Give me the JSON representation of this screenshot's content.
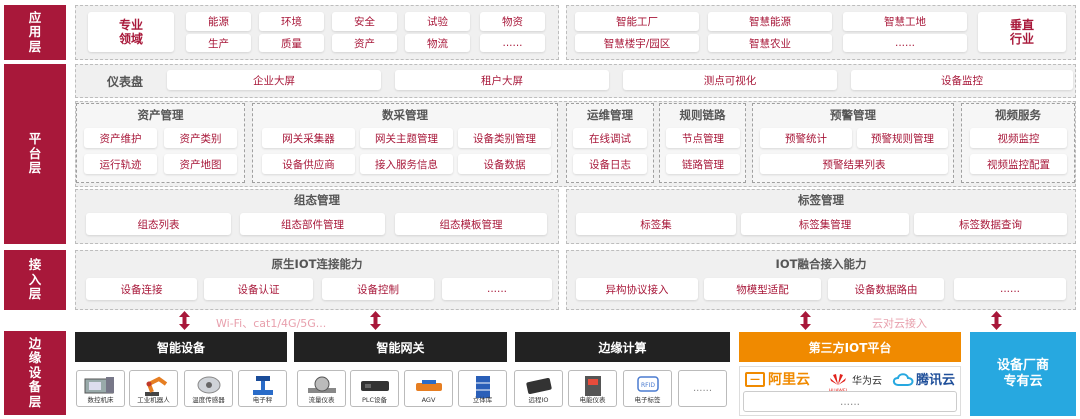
{
  "layers": {
    "app": "应用层",
    "platform": "平台层",
    "access": "接入层",
    "edge": "边缘设备层"
  },
  "app": {
    "left_tag": "专业\n领域",
    "left_items": [
      "能源",
      "环境",
      "安全",
      "试验",
      "物资",
      "生产",
      "质量",
      "资产",
      "物流",
      "......"
    ],
    "right_items": [
      "智能工厂",
      "智慧能源",
      "智慧工地",
      "智慧楼宇/园区",
      "智慧农业",
      "......"
    ],
    "right_tag": "垂直\n行业"
  },
  "platform": {
    "dashboard_label": "仪表盘",
    "dashboard_items": [
      "企业大屏",
      "租户大屏",
      "测点可视化",
      "设备监控"
    ],
    "asset": {
      "title": "资产管理",
      "items": [
        "资产维护",
        "资产类别",
        "运行轨迹",
        "资产地图"
      ]
    },
    "collect": {
      "title": "数采管理",
      "items": [
        "网关采集器",
        "网关主题管理",
        "设备类别管理",
        "设备供应商",
        "接入服务信息",
        "设备数据"
      ]
    },
    "ops": {
      "title": "运维管理",
      "items": [
        "在线调试",
        "设备日志"
      ]
    },
    "rule": {
      "title": "规则链路",
      "items": [
        "节点管理",
        "链路管理"
      ]
    },
    "alarm": {
      "title": "预警管理",
      "items": [
        "预警统计",
        "预警规则管理",
        "预警结果列表"
      ]
    },
    "video": {
      "title": "视频服务",
      "items": [
        "视频监控",
        "视频监控配置"
      ]
    },
    "config": {
      "title": "组态管理",
      "items": [
        "组态列表",
        "组态部件管理",
        "组态模板管理"
      ]
    },
    "tag": {
      "title": "标签管理",
      "items": [
        "标签集",
        "标签集管理",
        "标签数据查询"
      ]
    }
  },
  "access": {
    "native": {
      "title": "原生IOT连接能力",
      "items": [
        "设备连接",
        "设备认证",
        "设备控制",
        "......"
      ]
    },
    "fusion": {
      "title": "IOT融合接入能力",
      "items": [
        "异构协议接入",
        "物模型适配",
        "设备数据路由",
        "......"
      ]
    }
  },
  "links": {
    "wifi": "Wi-Fi、cat1/4G/5G...",
    "cloud": "云对云接入"
  },
  "edge": {
    "bars": [
      "智能设备",
      "智能网关",
      "边缘计算",
      "第三方IOT平台",
      "设备厂商\n专有云"
    ],
    "smart_devices": [
      "数控机床",
      "工业机器人",
      "温度传感器",
      "电子秤"
    ],
    "gateways": [
      "流量仪表",
      "PLC设备",
      "AGV",
      "立体库"
    ],
    "edge_devices": [
      "远程IO",
      "电能仪表",
      "电子标签",
      "......"
    ],
    "platforms": [
      "阿里云",
      "华为云",
      "腾讯云"
    ],
    "platforms_more": "......",
    "huawei_brand": "HUAWEI"
  },
  "colors": {
    "brand": "#a8183a",
    "orange": "#f08a00",
    "blue": "#27a8e0",
    "dark": "#222222"
  }
}
